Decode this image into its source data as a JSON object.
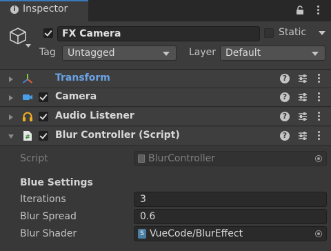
{
  "tab": {
    "title": "Inspector",
    "info_icon": "info-icon",
    "lock_icon": "lock-icon",
    "menu_icon": "kebab-menu-icon"
  },
  "gameobject": {
    "icon": "cube-icon",
    "active": true,
    "name": "FX Camera",
    "static_label": "Static",
    "static": false,
    "tag_label": "Tag",
    "tag_value": "Untagged",
    "layer_label": "Layer",
    "layer_value": "Default"
  },
  "components": [
    {
      "name": "Transform",
      "icon": "transform-icon",
      "has_checkbox": false,
      "expanded": false
    },
    {
      "name": "Camera",
      "icon": "camera-icon",
      "has_checkbox": true,
      "enabled": true,
      "expanded": false
    },
    {
      "name": "Audio Listener",
      "icon": "headphones-icon",
      "has_checkbox": true,
      "enabled": true,
      "expanded": false
    },
    {
      "name": "Blur Controller (Script)",
      "icon": "csharp-script-icon",
      "has_checkbox": true,
      "enabled": true,
      "expanded": true
    }
  ],
  "blur_controller": {
    "script_label": "Script",
    "script_value": "BlurController",
    "section_header": "Blue Settings",
    "iterations_label": "Iterations",
    "iterations_value": "3",
    "spread_label": "Blur Spread",
    "spread_value": "0.6",
    "shader_label": "Blur Shader",
    "shader_value": "VueCode/BlurEffect"
  },
  "colors": {
    "accent": "#3a79bb",
    "transform_label": "#6aa3e6",
    "background": "#383838"
  }
}
